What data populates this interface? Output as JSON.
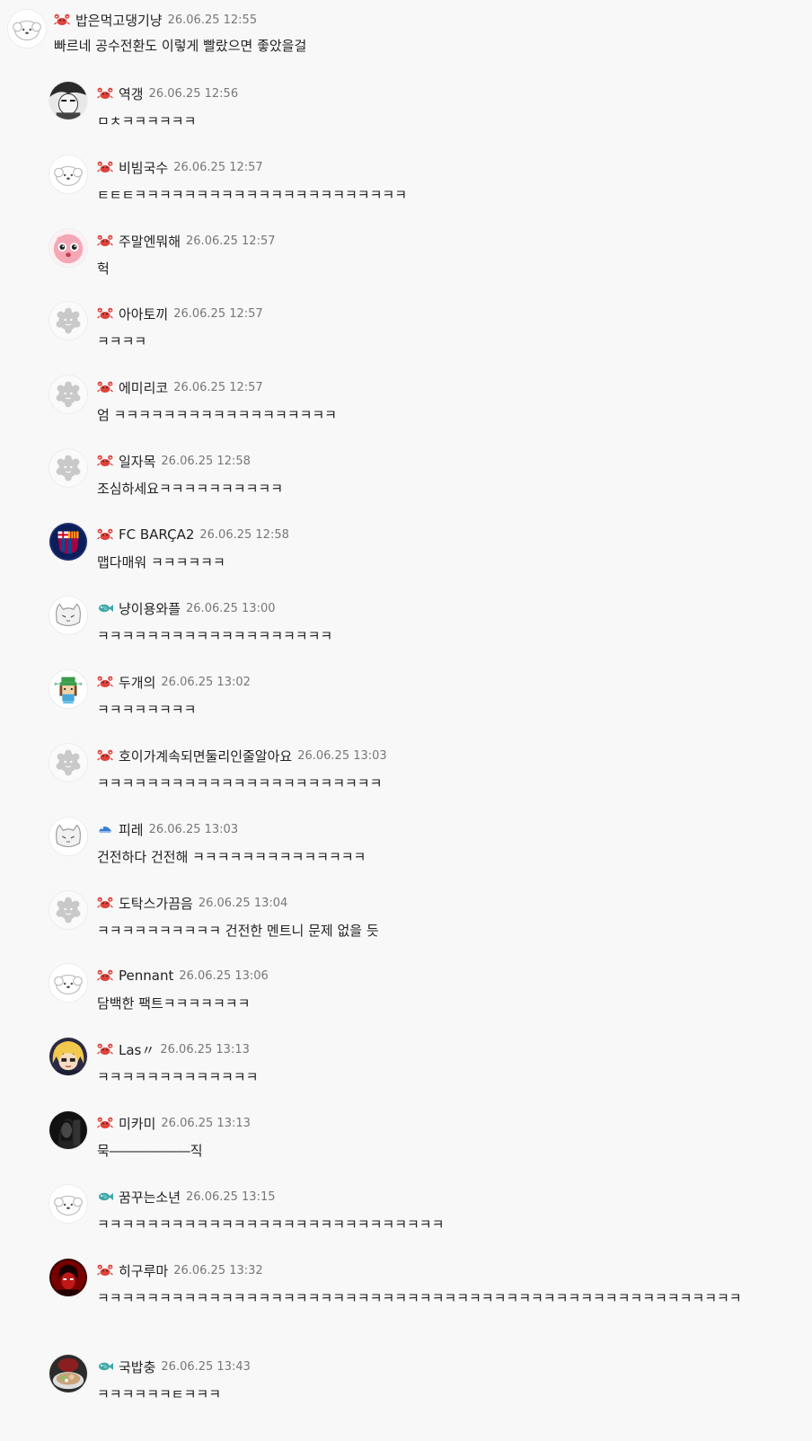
{
  "comments": [
    {
      "nick": "밥은먹고댕기냥",
      "time": "26.06.25 12:55",
      "text": "빠르네 공수전환도 이렇게 빨랐으면 좋았을걸",
      "badge": "crab-icon",
      "avatar": "white-dog-avatar"
    },
    {
      "nick": "역갱",
      "time": "26.06.25 12:56",
      "text": "ㅁㅊㅋㅋㅋㅋㅋㅋ",
      "badge": "crab-icon",
      "avatar": "manga-avatar"
    },
    {
      "nick": "비빔국수",
      "time": "26.06.25 12:57",
      "text": "ㅌㅌㅌㅋㅋㅋㅋㅋㅋㅋㅋㅋㅋㅋㅋㅋㅋㅋㅋㅋㅋㅋㅋㅋㅋ",
      "badge": "crab-icon",
      "avatar": "white-dog-avatar"
    },
    {
      "nick": "주말엔뭐해",
      "time": "26.06.25 12:57",
      "text": "헉",
      "badge": "crab-icon",
      "avatar": "pink-character-avatar"
    },
    {
      "nick": "아아토끼",
      "time": "26.06.25 12:57",
      "text": "ㅋㅋㅋㅋ",
      "badge": "crab-icon",
      "avatar": "gray-default-avatar"
    },
    {
      "nick": "에미리코",
      "time": "26.06.25 12:57",
      "text": "엄 ㅋㅋㅋㅋㅋㅋㅋㅋㅋㅋㅋㅋㅋㅋㅋㅋㅋㅋ",
      "badge": "crab-icon",
      "avatar": "gray-default-avatar"
    },
    {
      "nick": "일자목",
      "time": "26.06.25 12:58",
      "text": "조심하세요ㅋㅋㅋㅋㅋㅋㅋㅋㅋㅋ",
      "badge": "crab-icon",
      "avatar": "gray-default-avatar"
    },
    {
      "nick": "FC BARÇA2",
      "time": "26.06.25 12:58",
      "text": "맵다매워 ㅋㅋㅋㅋㅋㅋ",
      "badge": "crab-icon",
      "avatar": "fc-barcelona-avatar"
    },
    {
      "nick": "냥이용와플",
      "time": "26.06.25 13:00",
      "text": "ㅋㅋㅋㅋㅋㅋㅋㅋㅋㅋㅋㅋㅋㅋㅋㅋㅋㅋㅋ",
      "badge": "fish-icon",
      "avatar": "cat-outline-avatar"
    },
    {
      "nick": "두개의",
      "time": "26.06.25 13:02",
      "text": "ㅋㅋㅋㅋㅋㅋㅋㅋ",
      "badge": "crab-icon",
      "avatar": "pixel-character-avatar"
    },
    {
      "nick": "호이가계속되면둘리인줄알아요",
      "time": "26.06.25 13:03",
      "text": "ㅋㅋㅋㅋㅋㅋㅋㅋㅋㅋㅋㅋㅋㅋㅋㅋㅋㅋㅋㅋㅋㅋㅋ",
      "badge": "crab-icon",
      "avatar": "gray-default-avatar"
    },
    {
      "nick": "피레",
      "time": "26.06.25 13:03",
      "text": "건전하다 건전해 ㅋㅋㅋㅋㅋㅋㅋㅋㅋㅋㅋㅋㅋㅋ",
      "badge": "blue-fish-icon",
      "avatar": "cat-outline-avatar"
    },
    {
      "nick": "도탁스가끔음",
      "time": "26.06.25 13:04",
      "text": "ㅋㅋㅋㅋㅋㅋㅋㅋㅋㅋ 건전한 멘트니 문제 없을 듯",
      "badge": "crab-icon",
      "avatar": "gray-default-avatar"
    },
    {
      "nick": "Pennant",
      "time": "26.06.25 13:06",
      "text": "담백한 팩트ㅋㅋㅋㅋㅋㅋㅋ",
      "badge": "crab-icon",
      "avatar": "white-dog-avatar"
    },
    {
      "nick": "Las〃",
      "time": "26.06.25 13:13",
      "text": "ㅋㅋㅋㅋㅋㅋㅋㅋㅋㅋㅋㅋㅋ",
      "badge": "crab-icon",
      "avatar": "anime-blonde-avatar"
    },
    {
      "nick": "미카미",
      "time": "26.06.25 13:13",
      "text": "묵――――――직",
      "badge": "crab-icon",
      "avatar": "dark-portrait-avatar"
    },
    {
      "nick": "꿈꾸는소년",
      "time": "26.06.25 13:15",
      "text": "ㅋㅋㅋㅋㅋㅋㅋㅋㅋㅋㅋㅋㅋㅋㅋㅋㅋㅋㅋㅋㅋㅋㅋㅋㅋㅋㅋㅋ",
      "badge": "fish-icon",
      "avatar": "white-dog-avatar"
    },
    {
      "nick": "히구루마",
      "time": "26.06.25 13:32",
      "text": "ㅋㅋㅋㅋㅋㅋㅋㅋㅋㅋㅋㅋㅋㅋㅋㅋㅋㅋㅋㅋㅋㅋㅋㅋㅋㅋㅋㅋㅋㅋㅋㅋㅋㅋㅋㅋㅋㅋㅋㅋㅋㅋㅋㅋㅋㅋㅋㅋㅋㅋㅋㅋ",
      "badge": "crab-icon",
      "avatar": "red-portrait-avatar"
    },
    {
      "nick": "국밥충",
      "time": "26.06.25 13:43",
      "text": "ㅋㅋㅋㅋㅋㅋㅌㅋㅋㅋ",
      "badge": "fish-icon",
      "avatar": "food-photo-avatar"
    }
  ]
}
